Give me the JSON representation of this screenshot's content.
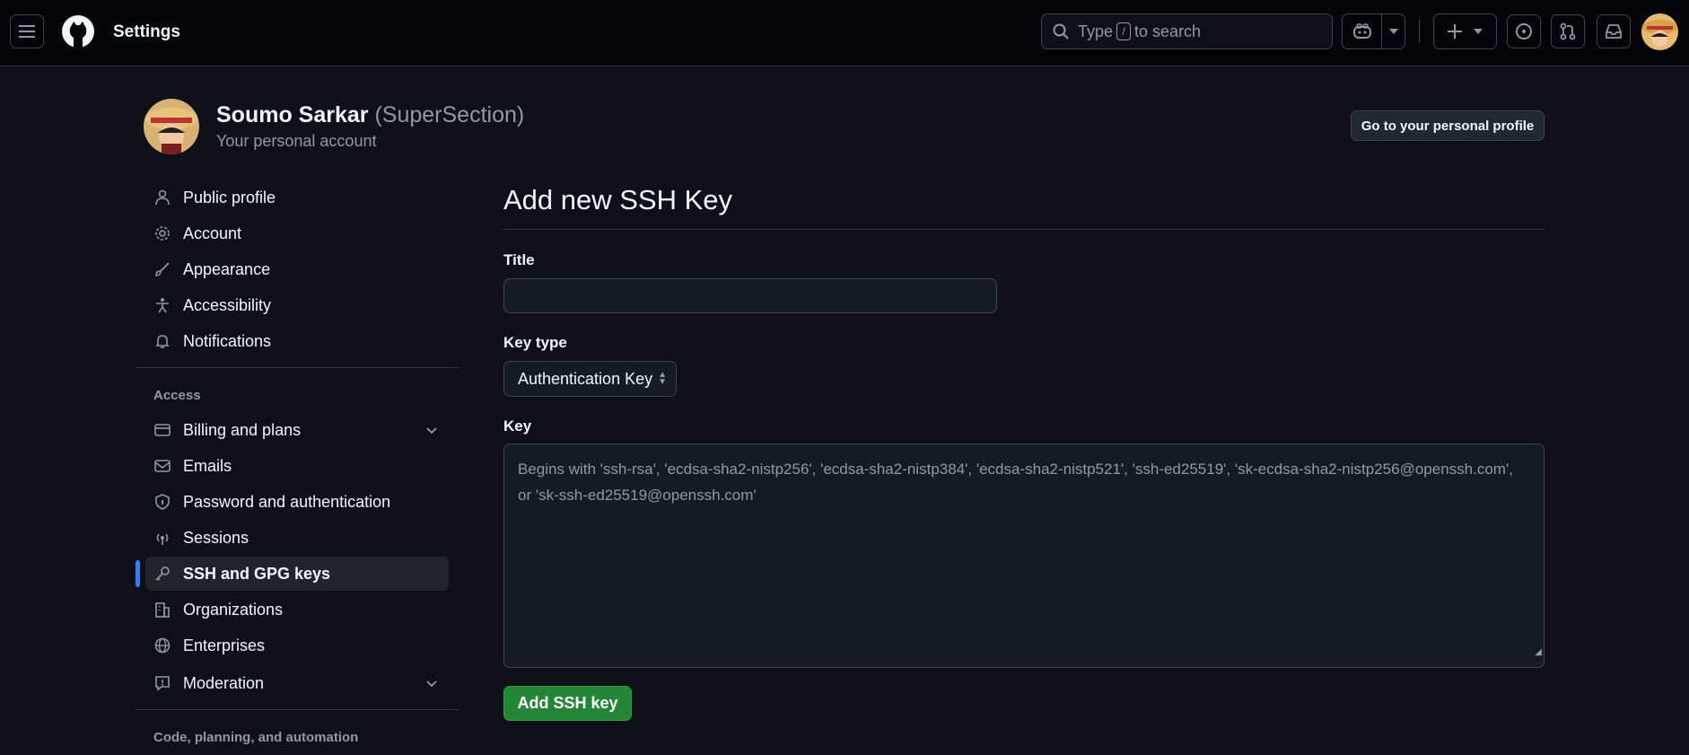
{
  "header": {
    "title": "Settings",
    "search": {
      "prefix": "Type",
      "kbd": "/",
      "suffix": "to search"
    }
  },
  "profile": {
    "name": "Soumo Sarkar",
    "handle": "(SuperSection)",
    "subtitle": "Your personal account",
    "go_profile_label": "Go to your personal profile"
  },
  "sidebar": {
    "items_top": [
      {
        "label": "Public profile",
        "icon": "person-icon"
      },
      {
        "label": "Account",
        "icon": "gear-icon"
      },
      {
        "label": "Appearance",
        "icon": "paintbrush-icon"
      },
      {
        "label": "Accessibility",
        "icon": "accessibility-icon"
      },
      {
        "label": "Notifications",
        "icon": "bell-icon"
      }
    ],
    "section_access": "Access",
    "items_access": [
      {
        "label": "Billing and plans",
        "icon": "credit-card-icon"
      },
      {
        "label": "Emails",
        "icon": "mail-icon"
      },
      {
        "label": "Password and authentication",
        "icon": "shield-lock-icon"
      },
      {
        "label": "Sessions",
        "icon": "broadcast-icon"
      },
      {
        "label": "SSH and GPG keys",
        "icon": "key-icon"
      },
      {
        "label": "Organizations",
        "icon": "organization-icon"
      },
      {
        "label": "Enterprises",
        "icon": "globe-icon"
      },
      {
        "label": "Moderation",
        "icon": "report-icon"
      }
    ],
    "section_code": "Code, planning, and automation"
  },
  "main": {
    "title": "Add new SSH Key",
    "title_label": "Title",
    "title_value": "",
    "key_type_label": "Key type",
    "key_type_value": "Authentication Key",
    "key_label": "Key",
    "key_placeholder": "Begins with 'ssh-rsa', 'ecdsa-sha2-nistp256', 'ecdsa-sha2-nistp384', 'ecdsa-sha2-nistp521', 'ssh-ed25519', 'sk-ecdsa-sha2-nistp256@openssh.com', or 'sk-ssh-ed25519@openssh.com'",
    "submit_label": "Add SSH key"
  },
  "colors": {
    "background": "#0d1117",
    "header_bg": "#010409",
    "accent": "#2f81f7",
    "primary_button": "#238636"
  }
}
